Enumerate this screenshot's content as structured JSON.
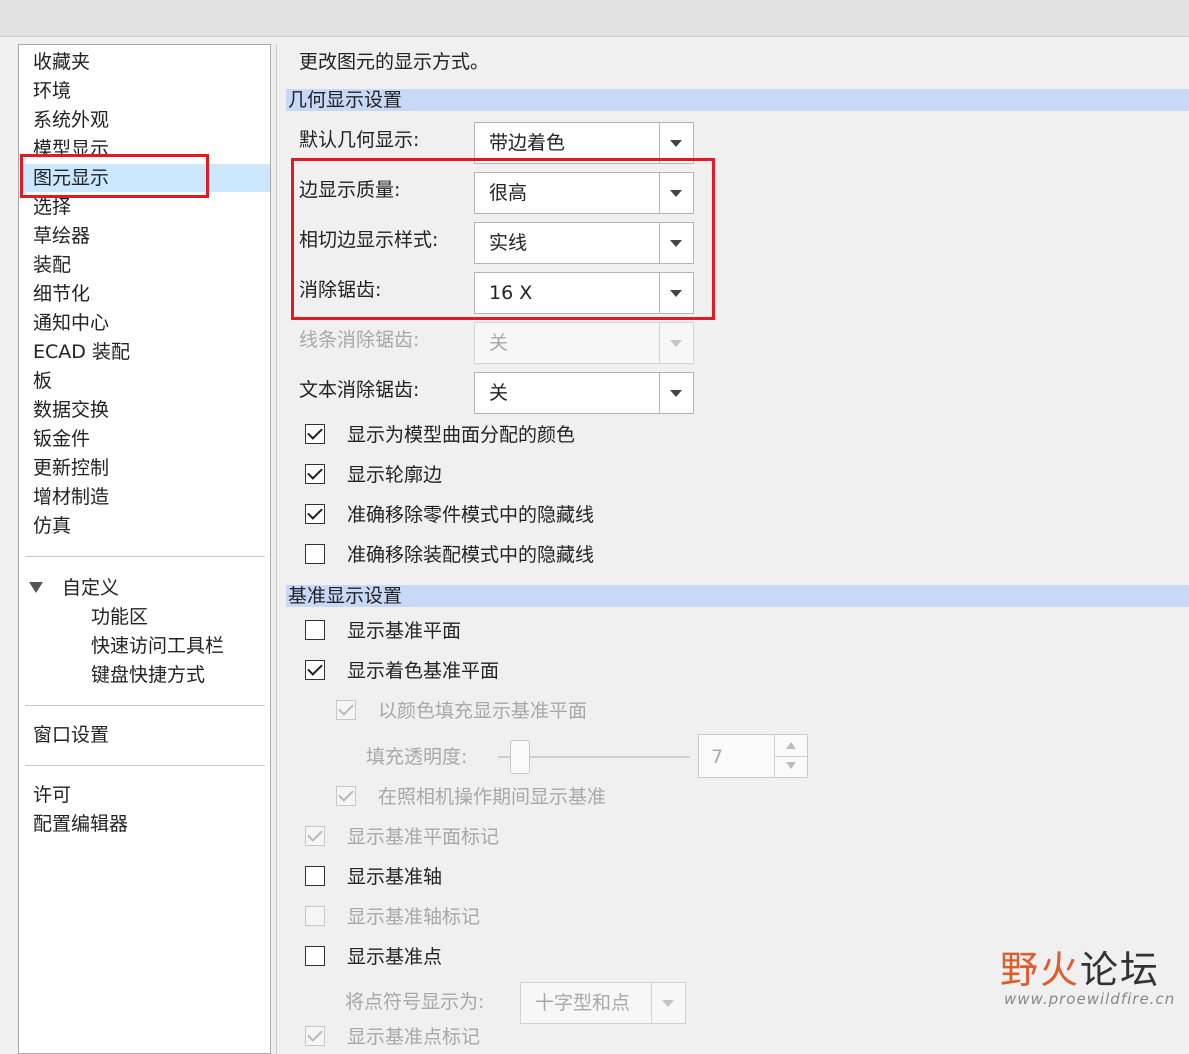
{
  "left_nav": {
    "items": [
      "收藏夹",
      "环境",
      "系统外观",
      "模型显示",
      "图元显示",
      "选择",
      "草绘器",
      "装配",
      "细节化",
      "通知中心",
      "ECAD 装配",
      "板",
      "数据交换",
      "钣金件",
      "更新控制",
      "增材制造",
      "仿真"
    ],
    "selected": "图元显示",
    "customize": {
      "label": "自定义",
      "children": [
        "功能区",
        "快速访问工具栏",
        "键盘快捷方式"
      ]
    },
    "window_settings": "窗口设置",
    "bottom": [
      "许可",
      "配置编辑器"
    ]
  },
  "main": {
    "description": "更改图元的显示方式。",
    "geometry_section": {
      "title": "几何显示设置",
      "rows": [
        {
          "label": "默认几何显示:",
          "value": "带边着色",
          "disabled": false
        },
        {
          "label": "边显示质量:",
          "value": "很高",
          "disabled": false
        },
        {
          "label": "相切边显示样式:",
          "value": "实线",
          "disabled": false
        },
        {
          "label": "消除锯齿:",
          "value": "16 X",
          "disabled": false
        },
        {
          "label": "线条消除锯齿:",
          "value": "关",
          "disabled": true
        },
        {
          "label": "文本消除锯齿:",
          "value": "关",
          "disabled": false
        }
      ],
      "checkboxes": [
        {
          "label": "显示为模型曲面分配的颜色",
          "checked": true,
          "disabled": false
        },
        {
          "label": "显示轮廓边",
          "checked": true,
          "disabled": false
        },
        {
          "label": "准确移除零件模式中的隐藏线",
          "checked": true,
          "disabled": false
        },
        {
          "label": "准确移除装配模式中的隐藏线",
          "checked": false,
          "disabled": false
        }
      ]
    },
    "datum_section": {
      "title": "基准显示设置",
      "checkboxes": [
        {
          "label": "显示基准平面",
          "checked": false,
          "disabled": false
        },
        {
          "label": "显示着色基准平面",
          "checked": true,
          "disabled": false
        },
        {
          "label": "以颜色填充显示基准平面",
          "checked": true,
          "disabled": true
        },
        {
          "label": "在照相机操作期间显示基准",
          "checked": true,
          "disabled": true
        },
        {
          "label": "显示基准平面标记",
          "checked": true,
          "disabled": true
        },
        {
          "label": "显示基准轴",
          "checked": false,
          "disabled": false
        },
        {
          "label": "显示基准轴标记",
          "checked": false,
          "disabled": true
        },
        {
          "label": "显示基准点",
          "checked": false,
          "disabled": false
        },
        {
          "label": "显示基准点标记",
          "checked": true,
          "disabled": true
        }
      ],
      "fill_transparency": {
        "label": "填充透明度:",
        "value": "7"
      },
      "point_symbol": {
        "label": "将点符号显示为:",
        "value": "十字型和点"
      }
    }
  },
  "watermark": {
    "text_red": "野火",
    "text_dark": "论坛",
    "url": "www.proewildfire.cn"
  }
}
